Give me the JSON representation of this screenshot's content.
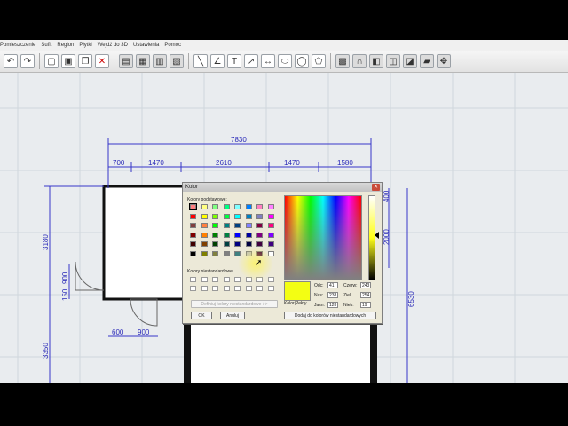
{
  "menu": [
    "Pomieszczenie",
    "Sufit",
    "Region",
    "Płytki",
    "Wejdź do 3D",
    "Ustawienia",
    "Pomoc"
  ],
  "toolbar": {
    "icons": [
      "undo-icon",
      "redo-icon",
      "copy-icon",
      "paste-icon",
      "clone-icon",
      "delete-icon",
      "wall-icon",
      "window-icon",
      "door-icon",
      "stairs-icon",
      "line-icon",
      "angle-icon",
      "text-icon",
      "arrow-icon",
      "dimension-icon",
      "ellipse-icon",
      "circle-icon",
      "polygon-icon",
      "view3d-icon",
      "arch-icon",
      "box-icon",
      "cylinder-icon",
      "cut-icon",
      "scale-icon",
      "move-icon"
    ]
  },
  "plan": {
    "total_dim": "7830",
    "top_dims": [
      "700",
      "1470",
      "2610",
      "1470",
      "1580"
    ],
    "left_dims": [
      "3180",
      "900",
      "150",
      "3350"
    ],
    "right_dims": [
      "400",
      "2000",
      "6530"
    ],
    "bottom_dims": [
      "600",
      "900"
    ]
  },
  "dialog": {
    "title": "Kolor",
    "basic_label": "Kolory podstawowe:",
    "custom_label": "Kolory niestandardowe:",
    "define_label": "Definiuj kolory niestandardowe >>",
    "ok_label": "OK",
    "cancel_label": "Anuluj",
    "color_solid_label": "Kolor|Pełny",
    "add_custom_label": "Dodaj do kolorów niestandardowych",
    "hue_label": "Odc:",
    "hue_value": "41",
    "sat_label": "Nas:",
    "sat_value": "238",
    "lum_label": "Jasn:",
    "lum_value": "128",
    "red_label": "Czerw:",
    "red_value": "243",
    "green_label": "Ziel:",
    "green_value": "254",
    "blue_label": "Nieb:",
    "blue_value": "19",
    "selected_color": "#f3fe13",
    "basic_colors": [
      [
        "#ff8080",
        "#ffff80",
        "#80ff80",
        "#00ff80",
        "#80ffff",
        "#0080ff",
        "#ff80c0",
        "#ff80ff"
      ],
      [
        "#ff0000",
        "#ffff00",
        "#80ff00",
        "#00ff40",
        "#00ffff",
        "#0080c0",
        "#8080c0",
        "#ff00ff"
      ],
      [
        "#804040",
        "#ff8040",
        "#00ff00",
        "#008080",
        "#004080",
        "#8080ff",
        "#800040",
        "#ff0080"
      ],
      [
        "#800000",
        "#ff8000",
        "#008000",
        "#008040",
        "#0000ff",
        "#0000a0",
        "#800080",
        "#8000ff"
      ],
      [
        "#400000",
        "#804000",
        "#004000",
        "#004040",
        "#000080",
        "#000040",
        "#400040",
        "#400080"
      ],
      [
        "#000000",
        "#808000",
        "#808040",
        "#808080",
        "#408080",
        "#c0c0c0",
        "#400040",
        "#ffffff"
      ]
    ]
  }
}
